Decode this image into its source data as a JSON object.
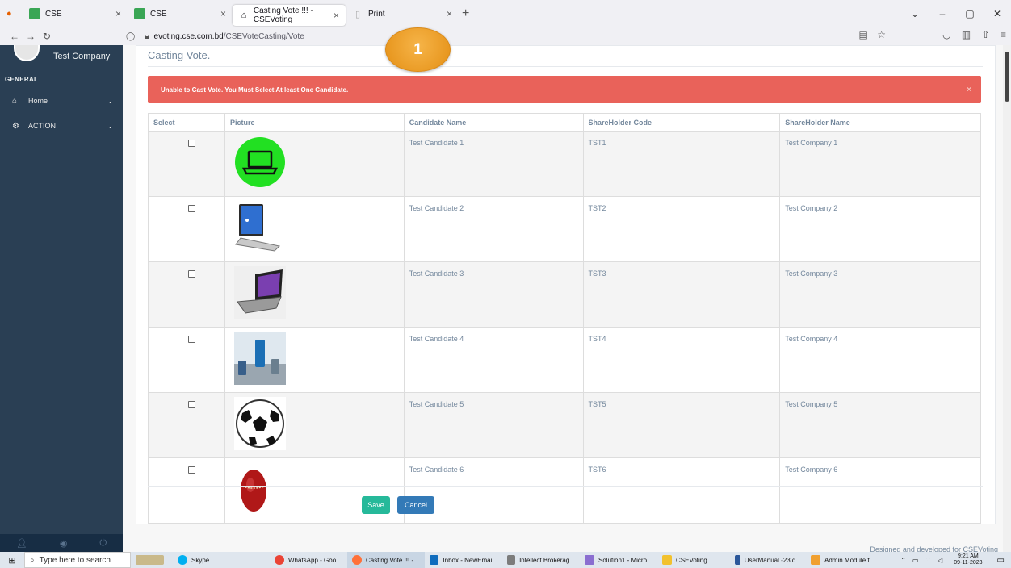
{
  "browser": {
    "tabs": [
      {
        "label": "CSE",
        "active": false
      },
      {
        "label": "CSE",
        "active": false
      },
      {
        "label": "Casting Vote !!! - CSEVoting",
        "active": true
      },
      {
        "label": "Print",
        "active": false
      }
    ],
    "new_tab": "+",
    "url_host": "evoting.cse.com.bd",
    "url_path": "/CSEVoteCasting/Vote"
  },
  "sidebar": {
    "company": "Test Company",
    "section": "GENERAL",
    "items": [
      {
        "label": "Home",
        "icon": "home-icon"
      },
      {
        "label": "ACTION",
        "icon": "cogs-icon"
      }
    ]
  },
  "main": {
    "title": "Casting Vote.",
    "alert": "Unable to Cast Vote. You Must Select At least One Candidate.",
    "alert_close": "×",
    "columns": [
      "Select",
      "Picture",
      "Candidate Name",
      "ShareHolder Code",
      "ShareHolder Name"
    ],
    "rows": [
      {
        "name": "Test Candidate 1",
        "code": "TST1",
        "holder": "Test Company 1",
        "picture": "laptop-green-icon"
      },
      {
        "name": "Test Candidate 2",
        "code": "TST2",
        "holder": "Test Company 2",
        "picture": "laptop-open-icon"
      },
      {
        "name": "Test Candidate 3",
        "code": "TST3",
        "holder": "Test Company 3",
        "picture": "laptop-windows-icon"
      },
      {
        "name": "Test Candidate 4",
        "code": "TST4",
        "holder": "Test Company 4",
        "picture": "smartphone-icon"
      },
      {
        "name": "Test Candidate 5",
        "code": "TST5",
        "holder": "Test Company 5",
        "picture": "football-icon"
      },
      {
        "name": "Test Candidate 6",
        "code": "TST6",
        "holder": "Test Company 6",
        "picture": "cricket-ball-icon"
      }
    ],
    "save_label": "Save",
    "cancel_label": "Cancel",
    "credit": "Designed and developed for CSEVoting"
  },
  "callout": "1",
  "taskbar": {
    "search_placeholder": "Type here to search",
    "items": [
      "Skype",
      "WhatsApp - Goo...",
      "Casting Vote !!! -...",
      "Inbox - NewEmai...",
      "Intellect Brokerag...",
      "Solution1 - Micro...",
      "CSEVoting",
      "UserManual -23.d...",
      "Admin Module f..."
    ],
    "time": "9:21 AM",
    "date": "09-11-2023"
  },
  "colors": {
    "sidebar": "#2a3f54",
    "alert": "#e9625a",
    "save": "#26b99a",
    "cancel": "#337ab7",
    "badge": "#f0a030"
  }
}
